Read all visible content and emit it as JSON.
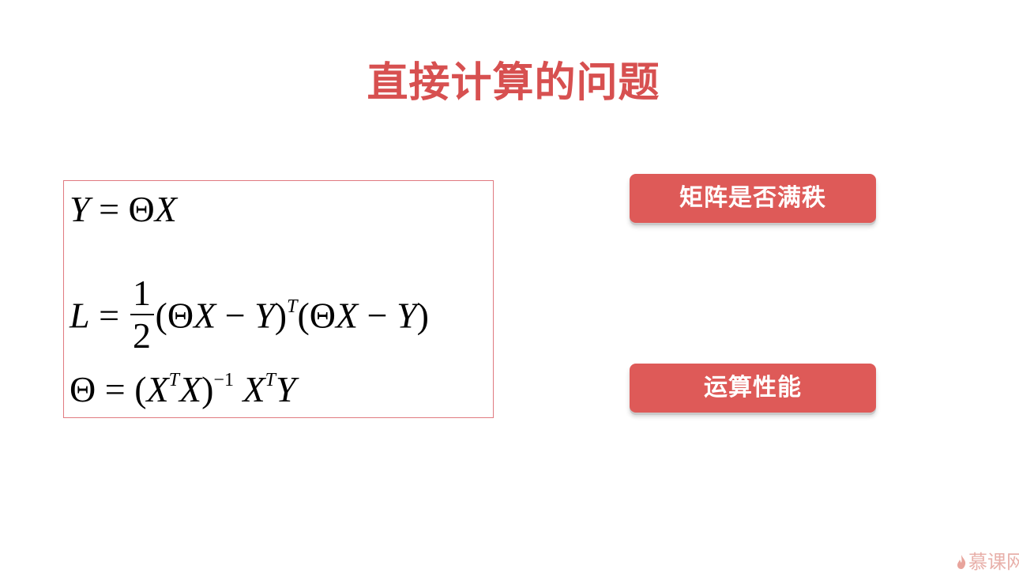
{
  "slide": {
    "title": "直接计算的问题"
  },
  "formulas": {
    "eq1": {
      "lhs": "Y",
      "eq": "=",
      "rhs_theta": "Θ",
      "rhs_x": "X"
    },
    "eq2": {
      "lhs": "L",
      "eq": "=",
      "frac_num": "1",
      "frac_den": "2",
      "open1": "(",
      "theta1": "Θ",
      "x1": "X",
      "minus1": "−",
      "y1": "Y",
      "close1": ")",
      "sup_t": "T",
      "open2": "(",
      "theta2": "Θ",
      "x2": "X",
      "minus2": "−",
      "y2": "Y",
      "close2": ")"
    },
    "eq3": {
      "lhs": "Θ",
      "eq": "=",
      "open": "(",
      "x1": "X",
      "sup_t1": "T",
      "x2": "X",
      "close": ")",
      "sup_inv": "−1",
      "x3": "X",
      "sup_t2": "T",
      "y": "Y"
    }
  },
  "tags": [
    {
      "label": "矩阵是否满秩"
    },
    {
      "label": "运算性能"
    }
  ],
  "watermark": {
    "text": "慕课网",
    "icon": "flame-icon"
  },
  "colors": {
    "title": "#d75050",
    "pill_bg": "#de5a58",
    "box_border": "#e07a80"
  }
}
